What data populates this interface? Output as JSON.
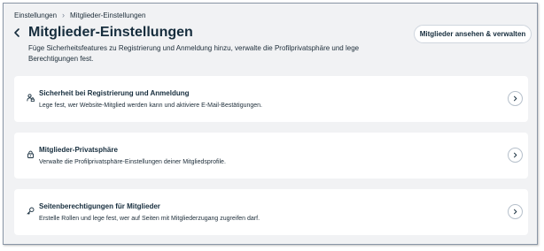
{
  "breadcrumb": {
    "items": [
      "Einstellungen",
      "Mitglieder-Einstellungen"
    ],
    "separator": "›"
  },
  "header": {
    "title": "Mitglieder-Einstellungen",
    "description": "Füge Sicherheitsfeatures zu Registrierung und Anmeldung hinzu, verwalte die Profilprivatsphäre und lege Berechtigungen fest.",
    "action_label": "Mitglieder ansehen & verwalten"
  },
  "cards": [
    {
      "icon": "user-lock-icon",
      "title": "Sicherheit bei Registrierung und Anmeldung",
      "subtitle": "Lege fest, wer Website-Mitglied werden kann und aktiviere E-Mail-Bestätigungen."
    },
    {
      "icon": "lock-icon",
      "title": "Mitglieder-Privatsphäre",
      "subtitle": "Verwalte die Profilprivatsphäre-Einstellungen deiner Mitgliedsprofile."
    },
    {
      "icon": "key-icon",
      "title": "Seitenberechtigungen für Mitglieder",
      "subtitle": "Erstelle Rollen und lege fest, wer auf Seiten mit Mitgliederzugang zugreifen darf."
    }
  ],
  "colors": {
    "page_background": "#f1f2f4",
    "card_background": "#ffffff",
    "text_primary": "#162d3d"
  }
}
